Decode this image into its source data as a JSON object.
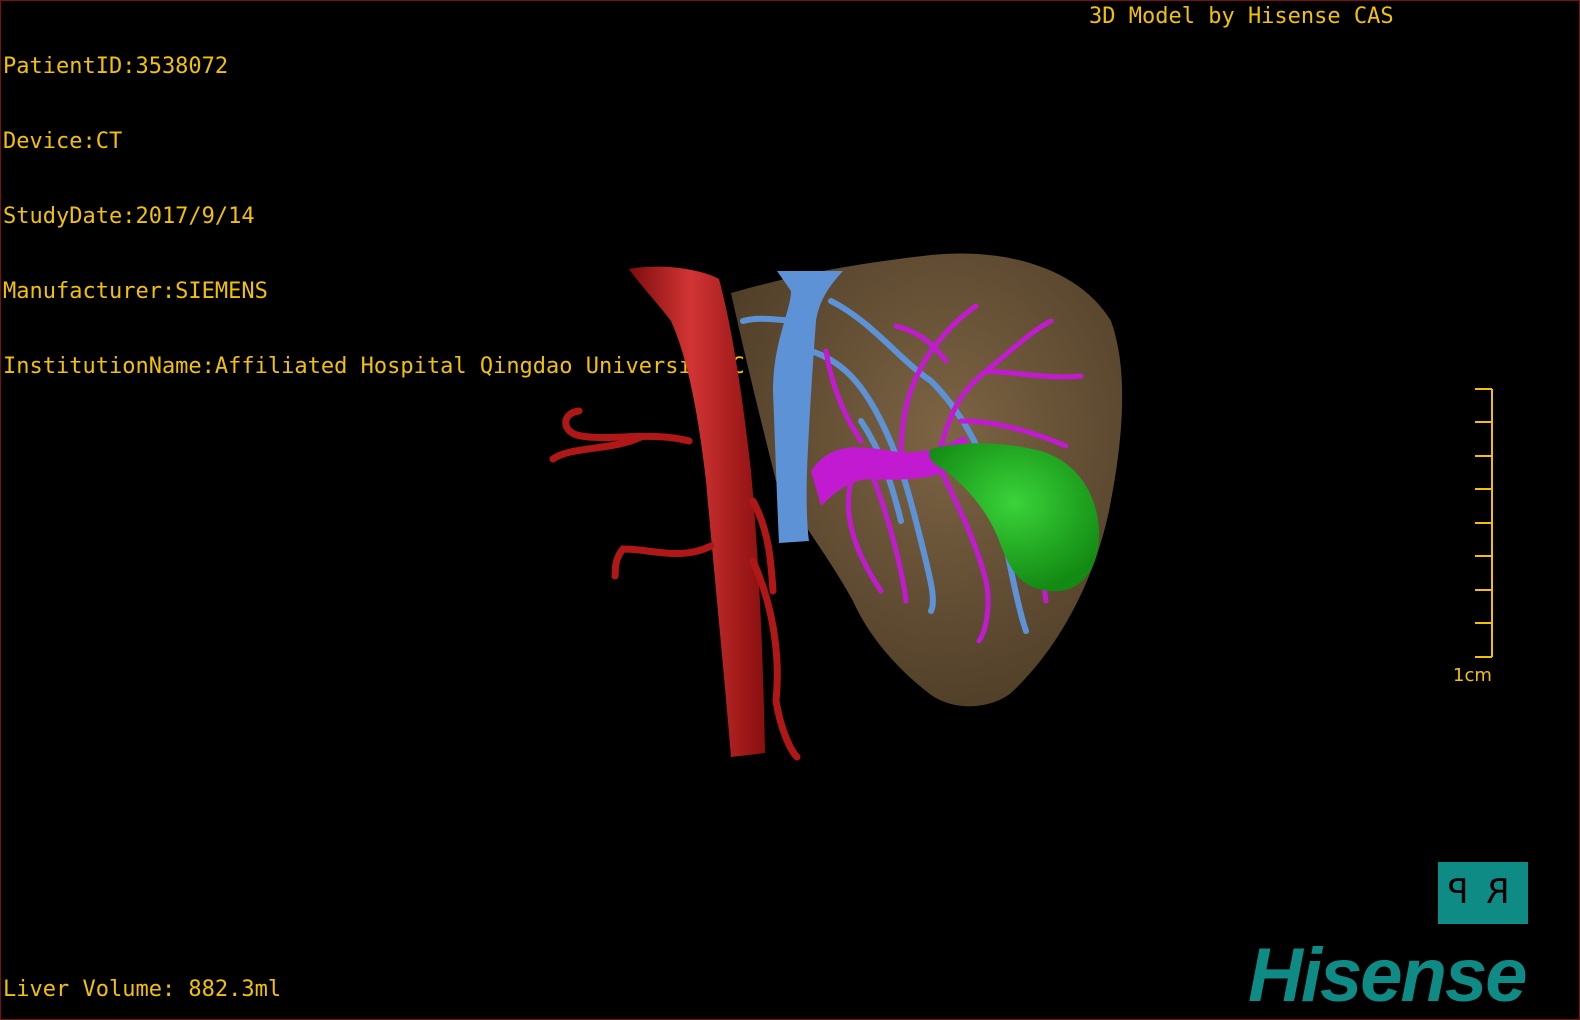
{
  "patient_info": {
    "patient_id": "PatientID:3538072",
    "device": "Device:CT",
    "study_date": "StudyDate:2017/9/14",
    "manufacturer": "Manufacturer:SIEMENS",
    "institution": "InstitutionName:Affiliated Hospital Qingdao University-C"
  },
  "model_credit": "3D Model by Hisense CAS",
  "liver_volume": "Liver Volume: 882.3ml",
  "scale_bar": {
    "label": "1cm",
    "ticks": 9
  },
  "orientation_cube": {
    "left_face": "P",
    "right_face": "R"
  },
  "brand": "Hisense",
  "colors": {
    "overlay_text": "#f2c200",
    "liver": "#6b5538",
    "aorta": "#b01818",
    "portal_vein": "#c21ad0",
    "hepatic_vein": "#5d93d6",
    "gallbladder": "#22b422",
    "brand": "#0f8b86"
  }
}
